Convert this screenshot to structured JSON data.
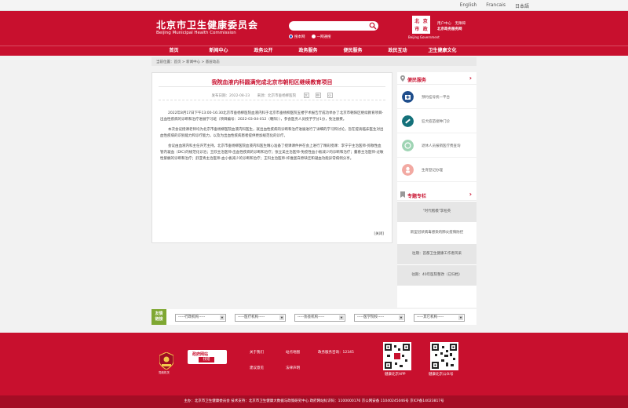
{
  "topbar": {
    "langs": [
      "English",
      "Francais",
      "日本語"
    ]
  },
  "header": {
    "title_cn": "北京市卫生健康委员会",
    "title_en": "Beijing Municipal Health Commission",
    "search_opt1": "搜本网",
    "search_opt2": "一网通搜",
    "seal_chars": [
      "北",
      "京",
      "市",
      "政"
    ],
    "seal_caption": "Beijing Government",
    "hall_line1": "用户中心　无障碍",
    "hall_line2": "北京政务服务网"
  },
  "nav": [
    "首页",
    "新闻中心",
    "政务公开",
    "政务服务",
    "便民服务",
    "政民互动",
    "卫生健康文化"
  ],
  "breadcrumb": "当前位置：首页 > 新闻中心 > 基层动态",
  "article": {
    "title": "我院血液内科圆满完成北京市朝阳区继续教育项目",
    "date_label": "发布日期：2022-08-23",
    "source_label": "来源：北京市垂杨柳医院",
    "font_controls": [
      "大",
      "中",
      "小"
    ],
    "paragraphs": [
      "2022年8月17日下午13:00-16:30北京市垂杨柳医院血液内科于北京市垂杨柳医院五楼学术报告厅成功举办了北京市朝阳区继续教育项目-出血性疾病的诊断和治疗进展学习班（项目编号：2022-03-04-012（朝阳）），参会医务人员授予学分1分，免注册费。",
      "本次会议授课老师均为北京市垂杨柳医院血液内科医生，就出血性疾病的诊断和治疗进展进行了详细的学习和讨论，旨在提高临床医生对出血性疾病的识别能力和诊疗能力，以及为出血性疾病患者提供更加规范化的诊疗。",
      "会议由血液内科主任许芳主持。北京市垂杨柳医院血液内科医生精心准备了授课课件并在会上进行了精彩授课：李宁宁主治医师-弥散性血管内凝血（DIC)的规范化诊治；王欣主治医师-出血性疾病的诊断和治疗；张立美主治医师-免疫性血小板减少的诊断和治疗；董春主治医师-过敏性紫癜的诊断和治疗；舒亚青主治医师-血小板减少的诊断和治疗；王科主治医师-纤维蛋白原缺乏和凝血功能异常病例分享。"
    ],
    "close_label": "[关闭]"
  },
  "sidebar": {
    "service_title": "便民服务",
    "services": [
      "预约挂号统一平台",
      "狂犬疫苗接种门诊",
      "退休人员报销医疗费查询",
      "生育登记办理"
    ],
    "feature_title": "专题专栏",
    "features": [
      "\"时代楷模\"李桓英",
      "新型冠状病毒感染的肺炎疫情防控",
      "往期：首都卫生健康工作者风采",
      "往期：40年医院整改（已归档）"
    ]
  },
  "links": {
    "tag_line1": "友情",
    "tag_line2": "链接",
    "selects": [
      "-----行政机构-----",
      "-----医疗机构-----",
      "-----协会机构-----",
      "-----医学院校-----",
      "-----其它机构-----"
    ]
  },
  "footer": {
    "emblem_caption": "党政机关",
    "badge_line1": "政府网站",
    "badge_line2": "找错",
    "link_about": "关于我们",
    "link_map": "站点地图",
    "link_gov_service": "政务服务咨询：12345",
    "link_feedback": "建议意见",
    "link_legal": "法律声明",
    "qr1_caption": "健康北京APP",
    "qr2_caption": "健康北京公众号",
    "bottom_line": "主办：北京市卫生健康委员会  技术支持：北京市卫生健康大数据与政策研究中心    政府网站标识码：1100000176  京公网安备 11040245046号  京ICP备14023817号"
  },
  "colors": {
    "brand_red": "#c8102e",
    "link_green": "#7fa832"
  }
}
